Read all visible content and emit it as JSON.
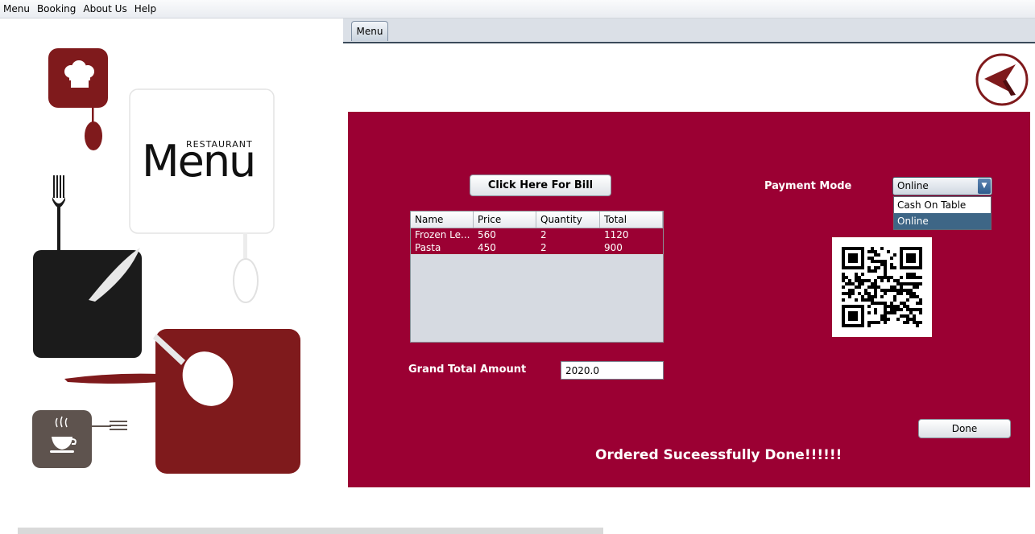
{
  "menubar": {
    "items": [
      "Menu",
      "Booking",
      "About Us",
      "Help"
    ]
  },
  "poster": {
    "word": "Menu",
    "subtitle": "RESTAURANT"
  },
  "tabs": [
    {
      "label": "Menu"
    }
  ],
  "icons": {
    "back": "back-arrow-icon",
    "combo_arrow": "chevron-down-icon",
    "chef": "chef-hat-icon",
    "coffee": "coffee-cup-icon"
  },
  "bill": {
    "button_label": "Click Here For Bill"
  },
  "table": {
    "columns": [
      "Name",
      "Price",
      "Quantity",
      "Total"
    ],
    "rows": [
      [
        "Frozen Le...",
        "560",
        "2",
        "1120"
      ],
      [
        "Pasta",
        "450",
        "2",
        "900"
      ]
    ]
  },
  "grand_total": {
    "label": "Grand Total Amount",
    "value": "2020.0"
  },
  "payment": {
    "label": "Payment Mode",
    "selected": "Online",
    "options": [
      "Cash On Table",
      "Online"
    ]
  },
  "done_label": "Done",
  "status_message": "Ordered Suceessfully Done!!!!!!",
  "colors": {
    "panel": "#9b0033",
    "poster_red": "#7f1a1c",
    "poster_black": "#1b1b1b",
    "poster_brown": "#5e534e"
  }
}
